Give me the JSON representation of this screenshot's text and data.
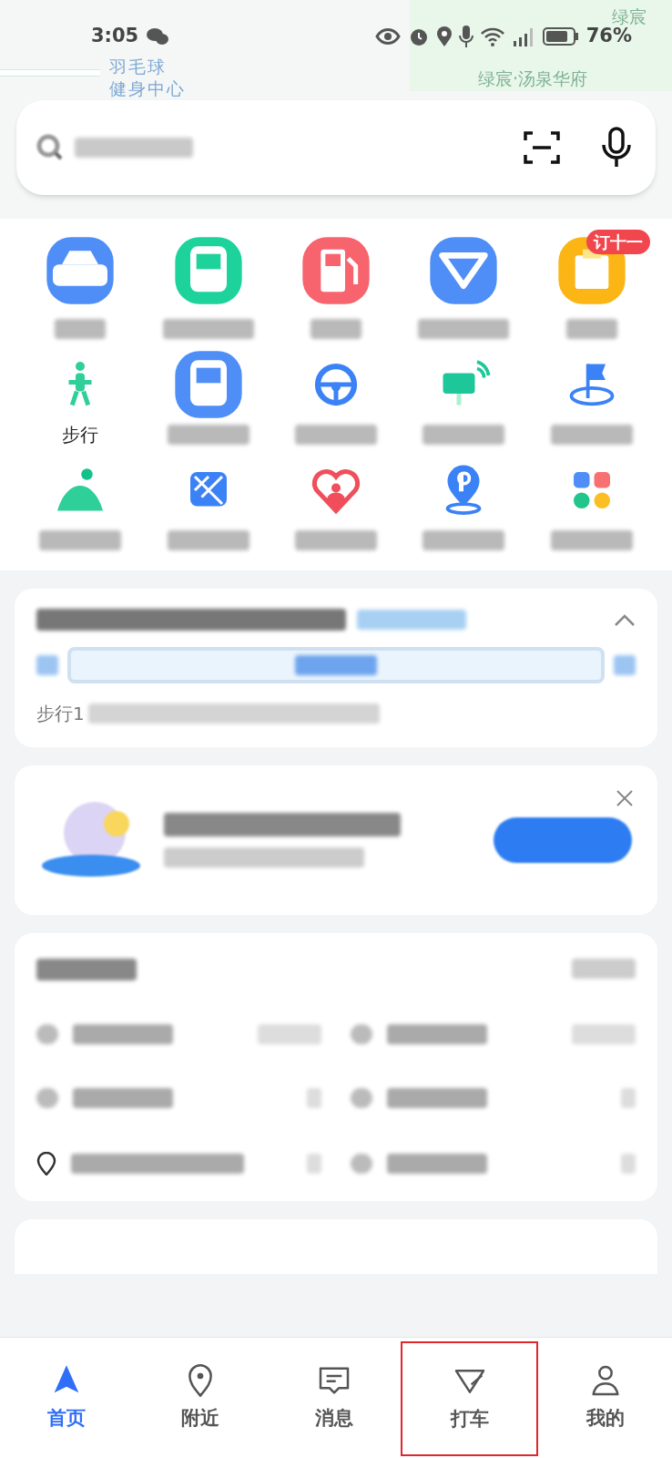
{
  "status_bar": {
    "time": "3:05",
    "battery": "76%"
  },
  "map": {
    "labels": [
      {
        "kind": "poi",
        "text": "羽毛球"
      },
      {
        "kind": "poi",
        "text": "健身中心"
      },
      {
        "kind": "area",
        "text": "绿宸·汤泉华府"
      },
      {
        "kind": "corner",
        "text": "绿宸"
      }
    ]
  },
  "shortcuts": [
    {
      "kind": "tile",
      "color": "#4f8ef7"
    },
    {
      "kind": "tile",
      "color": "#1dd39b"
    },
    {
      "kind": "tile",
      "color": "#f7646e"
    },
    {
      "kind": "tile",
      "color": "#4f8ef7"
    },
    {
      "kind": "tile",
      "color": "#fbb515",
      "badge": "订十一"
    },
    {
      "kind": "glyph",
      "color": "#2ecf98",
      "label": "步行"
    },
    {
      "kind": "glyph",
      "color": "#4f8ef7"
    },
    {
      "kind": "glyph",
      "color": "#3b82f6"
    },
    {
      "kind": "glyph",
      "color": "#1dc79a"
    },
    {
      "kind": "glyph",
      "color": "#3b82f6"
    },
    {
      "kind": "glyph",
      "color": "#2ecf98"
    },
    {
      "kind": "glyph",
      "color": "#3b82f6"
    },
    {
      "kind": "glyph",
      "color": "#ef4e5a"
    },
    {
      "kind": "glyph",
      "color": "#3b82f6"
    },
    {
      "kind": "glyph",
      "color": "#4f8ef7"
    }
  ],
  "route_card": {
    "summary_prefix": "步行1",
    "expanded": true
  },
  "tabs": [
    {
      "label": "首页",
      "selected": true,
      "highlighted": false
    },
    {
      "label": "附近",
      "selected": false,
      "highlighted": false
    },
    {
      "label": "消息",
      "selected": false,
      "highlighted": false
    },
    {
      "label": "打车",
      "selected": false,
      "highlighted": true
    },
    {
      "label": "我的",
      "selected": false,
      "highlighted": false
    }
  ]
}
